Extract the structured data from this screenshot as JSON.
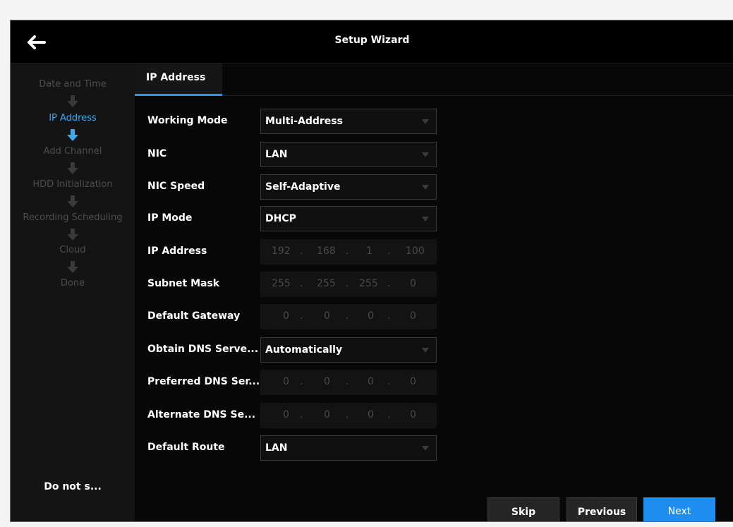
{
  "header": {
    "title": "Setup Wizard"
  },
  "sidebar": {
    "steps": [
      {
        "label": "Date and Time"
      },
      {
        "label": "IP Address"
      },
      {
        "label": "Add Channel"
      },
      {
        "label": "HDD Initialization"
      },
      {
        "label": "Recording Scheduling"
      },
      {
        "label": "Cloud"
      },
      {
        "label": "Done"
      }
    ],
    "do_not_show_label": "Do not s..."
  },
  "tabs": [
    {
      "label": "IP Address"
    }
  ],
  "form": {
    "working_mode": {
      "label": "Working Mode",
      "value": "Multi-Address"
    },
    "nic": {
      "label": "NIC",
      "value": "LAN"
    },
    "nic_speed": {
      "label": "NIC Speed",
      "value": "Self-Adaptive"
    },
    "ip_mode": {
      "label": "IP Mode",
      "value": "DHCP"
    },
    "ip_address": {
      "label": "IP Address",
      "octets": [
        "192",
        "168",
        "1",
        "100"
      ]
    },
    "subnet_mask": {
      "label": "Subnet Mask",
      "octets": [
        "255",
        "255",
        "255",
        "0"
      ]
    },
    "default_gateway": {
      "label": "Default Gateway",
      "octets": [
        "0",
        "0",
        "0",
        "0"
      ]
    },
    "obtain_dns": {
      "label": "Obtain DNS Serve...",
      "value": "Automatically"
    },
    "preferred_dns": {
      "label": "Preferred DNS Ser...",
      "octets": [
        "0",
        "0",
        "0",
        "0"
      ]
    },
    "alternate_dns": {
      "label": "Alternate DNS Se...",
      "octets": [
        "0",
        "0",
        "0",
        "0"
      ]
    },
    "default_route": {
      "label": "Default Route",
      "value": "LAN"
    },
    "ip_separator": "."
  },
  "buttons": {
    "skip": "Skip",
    "previous": "Previous",
    "next": "Next"
  },
  "colors": {
    "accent": "#1e8ef0",
    "active_step": "#3fa9ef",
    "background": "#000000"
  }
}
